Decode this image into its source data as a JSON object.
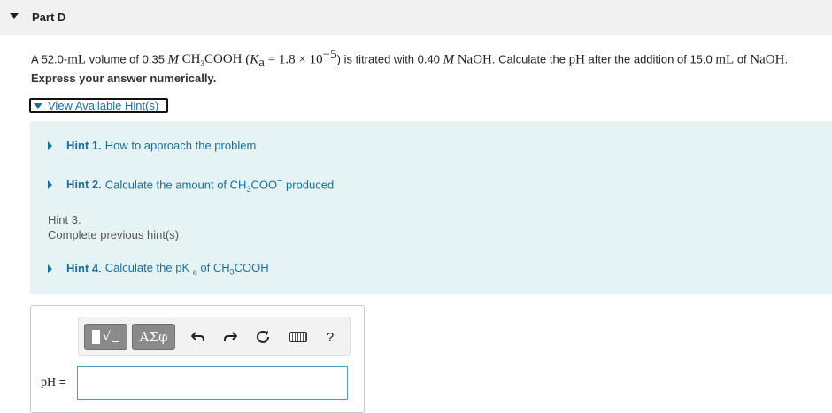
{
  "part": {
    "title": "Part D"
  },
  "question": {
    "p1": "A 52.0-",
    "unit_ml": "mL",
    "p2": " volume of 0.35 ",
    "m1": "M",
    "formula_a": "CH",
    "formula_sub3": "3",
    "formula_b": "COOH",
    "ka_open": " (",
    "ka_k": "K",
    "ka_sub": "a",
    "ka_rest": " = 1.8 × 10",
    "ka_exp": "−5",
    "ka_close": ")",
    "p3": " is titrated with 0.40 ",
    "m2": "M",
    "naoh1": "NaOH",
    "p4": ". Calculate the ",
    "ph": "pH",
    "p5": " after the addition of 15.0 ",
    "unit_ml2": "mL",
    "p6": " of ",
    "naoh2": "NaOH",
    "p7": "."
  },
  "express": "Express your answer numerically.",
  "hints_toggle": "View Available Hint(s)",
  "hints": {
    "h1": {
      "num": "Hint 1.",
      "text": "How to approach the problem"
    },
    "h2": {
      "num": "Hint 2.",
      "text_a": "Calculate the amount of CH",
      "sub": "3",
      "text_b": "COO",
      "sup": "−",
      "text_c": " produced"
    },
    "h3": {
      "num": "Hint 3.",
      "text": "Complete previous hint(s)"
    },
    "h4": {
      "num": "Hint 4.",
      "text_a": "Calculate the p",
      "k": "K",
      "sub_a": "a",
      "text_b": " of CH",
      "sub3": "3",
      "text_c": "COOH"
    }
  },
  "toolbar": {
    "templates_icon": "templates-icon",
    "greek_label": "ΑΣφ",
    "undo_icon": "undo-icon",
    "redo_icon": "redo-icon",
    "reset_icon": "reset-icon",
    "keyboard_icon": "keyboard-icon",
    "help_label": "?"
  },
  "answer": {
    "label": "pH",
    "equals": " =",
    "value": ""
  },
  "colors": {
    "link": "#1a6fa0",
    "hint_bg": "#e6f3f4",
    "header_bg": "#f1f1f1",
    "input_border": "#4a9fc4"
  }
}
